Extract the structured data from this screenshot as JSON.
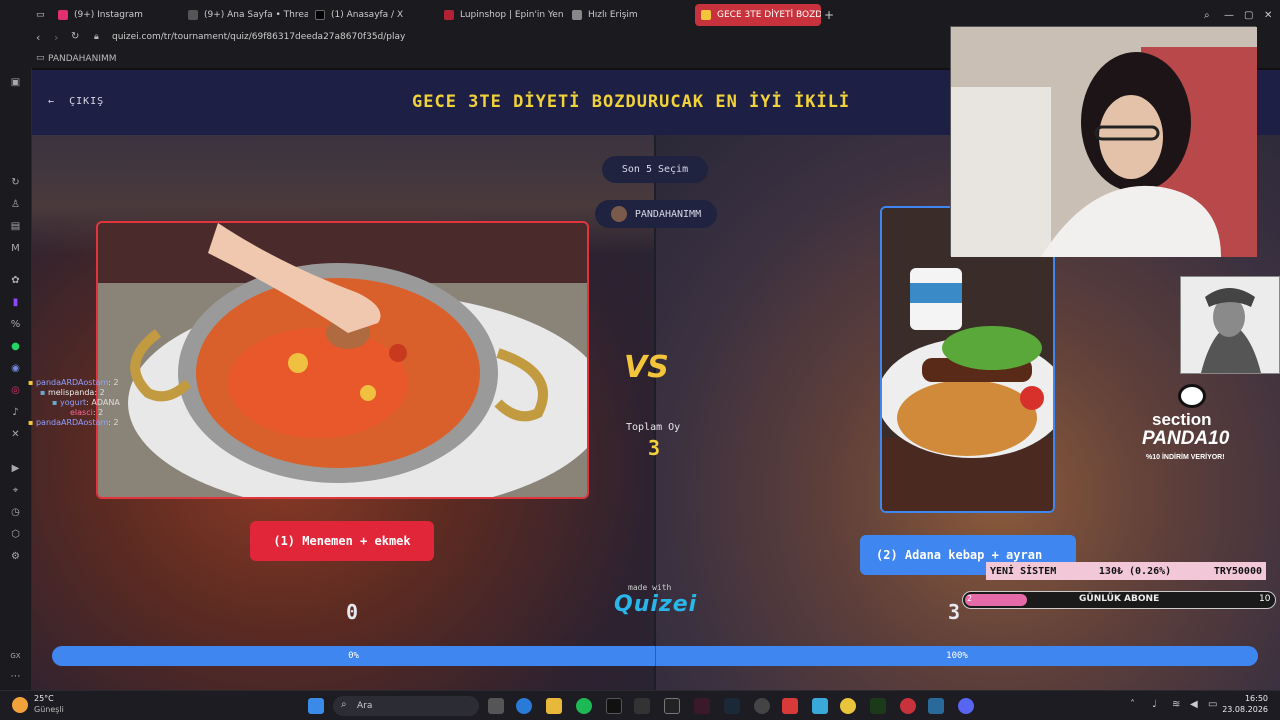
{
  "browser": {
    "tabs": [
      {
        "label": "(9+) Instagram",
        "color": "#e1306c"
      },
      {
        "label": "(9+) Ana Sayfa • Threads",
        "color": "#222222"
      },
      {
        "label": "(1) Anasayfa / X",
        "color": "#000000"
      },
      {
        "label": "Lupinshop | Epin'in Yeni Mu",
        "color": "#b22234"
      },
      {
        "label": "Hızlı Erişim",
        "color": "#888888"
      },
      {
        "label": "GECE 3TE DİYETİ BOZDUR",
        "color": "#f2c53a"
      }
    ],
    "new_tab": "+",
    "url": "quizei.com/tr/tournament/quiz/69f86317deeda27a8670f35d/play",
    "bookmark_folder": "PANDAHANIMM"
  },
  "page": {
    "exit_label": "ÇIKIŞ",
    "title": "GECE 3TE DİYETİ BOZDURUCAK EN İYİ İKİLİ",
    "last_choices_label": "Son 5 Seçim",
    "user_label": "PANDAHANIMM",
    "vs_label": "VS",
    "total_votes_label": "Toplam Oy",
    "total_votes": "3",
    "left_choice": "(1) Menemen + ekmek",
    "right_choice": "(2) Adana kebap + ayran",
    "left_score": "0",
    "right_score": "3",
    "made_with": "made with",
    "logo": "Quizei",
    "left_percent": "0%",
    "right_percent": "100%",
    "progress": {
      "left_fraction": 0.0,
      "right_fraction": 1.0
    },
    "accent_colors": {
      "left": "#e2263a",
      "right": "#3f86f0",
      "title": "#f2d23a"
    }
  },
  "overlays": {
    "promo": {
      "line1": "section",
      "line2": "PANDA10",
      "line3": "%10 İNDİRİM VERİYOR!"
    },
    "ticker": {
      "name": "YENİ SİSTEM",
      "value": "130₺ (0.26%)",
      "goal": "TRY50000"
    },
    "sub_goal": {
      "label": "GÜNLÜK ABONE",
      "current": "2",
      "target": "10",
      "fraction": 0.2
    },
    "chat": [
      {
        "user": "pandaARDAostam",
        "msg": "2"
      },
      {
        "user": "melispanda",
        "msg": "2"
      },
      {
        "user": "yogurt",
        "msg": "ADANA"
      },
      {
        "user": "elasci",
        "msg": "2"
      },
      {
        "user": "pandaARDAostam",
        "msg": "2"
      }
    ]
  },
  "taskbar": {
    "weather_temp": "25°C",
    "weather_desc": "Güneşli",
    "search_placeholder": "Ara",
    "time": "16:50",
    "date": "23.08.2026"
  }
}
